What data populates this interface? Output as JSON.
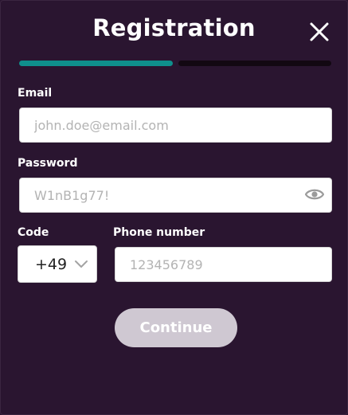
{
  "dialog": {
    "title": "Registration"
  },
  "progress": {
    "steps_total": 2,
    "current_step": 1,
    "active_color": "#0f8f8c",
    "inactive_color": "#120812"
  },
  "fields": {
    "email": {
      "label": "Email",
      "placeholder": "john.doe@email.com",
      "value": ""
    },
    "password": {
      "label": "Password",
      "placeholder": "W1nB1g77!",
      "value": "",
      "toggle_icon": "eye-icon"
    },
    "code": {
      "label": "Code",
      "selected": "+49"
    },
    "phone": {
      "label": "Phone number",
      "placeholder": "123456789",
      "value": ""
    }
  },
  "actions": {
    "continue_label": "Continue",
    "close_icon": "close-icon"
  },
  "colors": {
    "background": "#2a1530",
    "continue_button": "#cfc8d2"
  }
}
